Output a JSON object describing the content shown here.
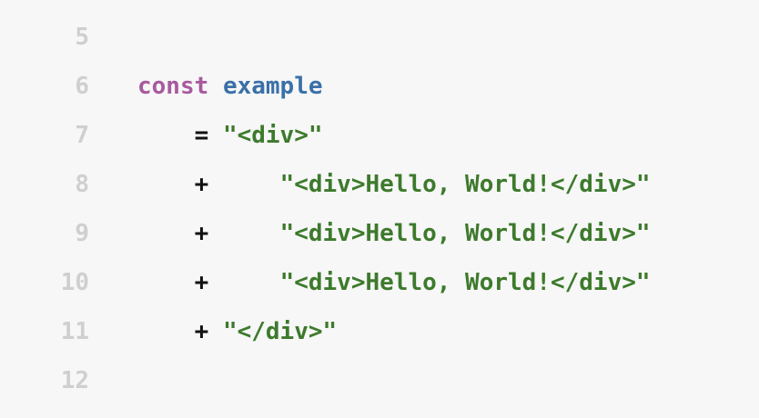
{
  "editor": {
    "colors": {
      "background": "#f7f7f7",
      "line_number": "#cfcfcf",
      "keyword": "#a85a9e",
      "identifier": "#3a70a8",
      "operator": "#111111",
      "string": "#3d7a2c"
    },
    "lines": [
      {
        "number": "5",
        "tokens": []
      },
      {
        "number": "6",
        "tokens": [
          {
            "type": "keyword",
            "text": "const"
          },
          {
            "type": "space",
            "text": " "
          },
          {
            "type": "identifier",
            "text": "example"
          }
        ]
      },
      {
        "number": "7",
        "tokens": [
          {
            "type": "space",
            "text": "    "
          },
          {
            "type": "operator",
            "text": "="
          },
          {
            "type": "space",
            "text": " "
          },
          {
            "type": "string",
            "text": "\"<div>\""
          }
        ]
      },
      {
        "number": "8",
        "tokens": [
          {
            "type": "space",
            "text": "    "
          },
          {
            "type": "operator",
            "text": "+"
          },
          {
            "type": "space",
            "text": "     "
          },
          {
            "type": "string",
            "text": "\"<div>Hello, World!</div>\""
          }
        ]
      },
      {
        "number": "9",
        "tokens": [
          {
            "type": "space",
            "text": "    "
          },
          {
            "type": "operator",
            "text": "+"
          },
          {
            "type": "space",
            "text": "     "
          },
          {
            "type": "string",
            "text": "\"<div>Hello, World!</div>\""
          }
        ]
      },
      {
        "number": "10",
        "tokens": [
          {
            "type": "space",
            "text": "    "
          },
          {
            "type": "operator",
            "text": "+"
          },
          {
            "type": "space",
            "text": "     "
          },
          {
            "type": "string",
            "text": "\"<div>Hello, World!</div>\""
          }
        ]
      },
      {
        "number": "11",
        "tokens": [
          {
            "type": "space",
            "text": "    "
          },
          {
            "type": "operator",
            "text": "+"
          },
          {
            "type": "space",
            "text": " "
          },
          {
            "type": "string",
            "text": "\"</div>\""
          }
        ]
      },
      {
        "number": "12",
        "tokens": []
      }
    ]
  }
}
